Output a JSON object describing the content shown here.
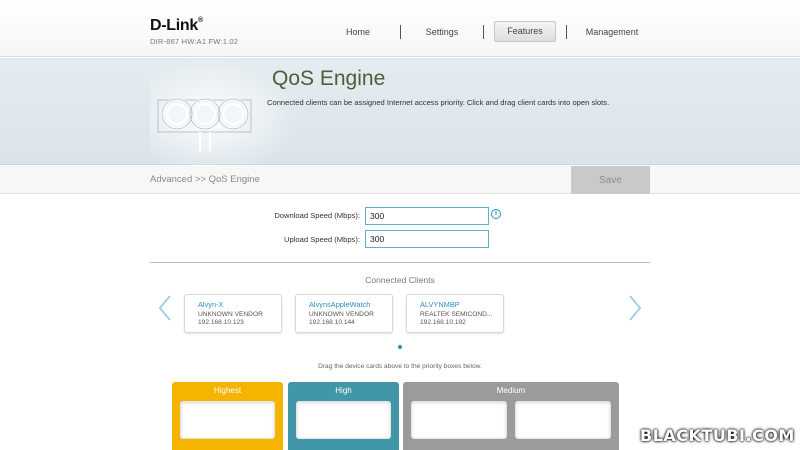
{
  "brand": {
    "logo": "D-Link",
    "reg_mark": "®",
    "subtitle": "DIR-867 HW:A1 FW:1.02"
  },
  "nav": {
    "items": [
      {
        "label": "Home"
      },
      {
        "label": "Settings"
      },
      {
        "label": "Features",
        "active": true
      },
      {
        "label": "Management"
      }
    ]
  },
  "hero": {
    "title": "QoS Engine",
    "description": "Connected clients can be assigned Internet access priority. Click and drag client cards into open slots."
  },
  "breadcrumb": "Advanced >> QoS Engine",
  "save_label": "Save",
  "speed": {
    "download_label": "Download Speed (Mbps):",
    "download_value": "300",
    "upload_label": "Upload Speed (Mbps):",
    "upload_value": "300",
    "info_glyph": "i"
  },
  "clients": {
    "title": "Connected Clients",
    "items": [
      {
        "name": "Alvyn-X",
        "vendor": "UNKNOWN VENDOR",
        "ip": "192.168.10.123"
      },
      {
        "name": "AlvynsAppleWatch",
        "vendor": "UNKNOWN VENDOR",
        "ip": "192.168.10.144"
      },
      {
        "name": "ALVYNMBP",
        "vendor": "REALTEK SEMICOND...",
        "ip": "192.168.10.192"
      }
    ],
    "hint": "Drag the device cards above to the priority boxes below."
  },
  "priorities": [
    {
      "label": "Highest",
      "color": "#f4b400"
    },
    {
      "label": "High",
      "color": "#4196a8"
    },
    {
      "label": "Medium",
      "color": "#9b9b9b"
    }
  ],
  "icons": {
    "prev": "chevron-left-icon",
    "next": "chevron-right-icon",
    "info": "info-icon"
  },
  "colors": {
    "accent": "#2a8fbf",
    "input_border": "#5fb0c8",
    "arrow": "#a8cfe0"
  },
  "watermark": "BLACKTUBI.COM"
}
